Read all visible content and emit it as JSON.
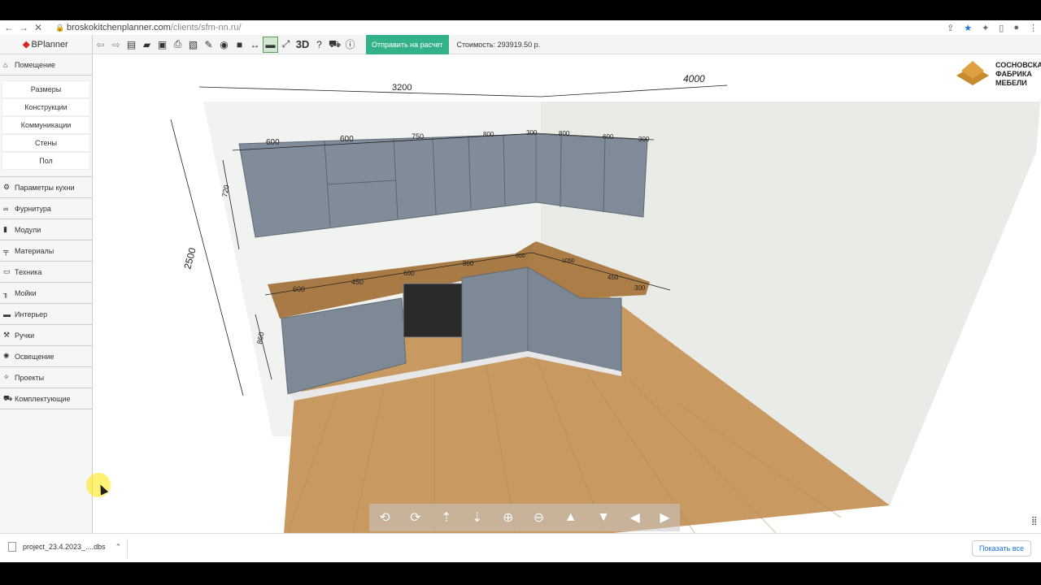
{
  "browser": {
    "url_host": "broskokitchenplanner.com",
    "url_path": "/clients/sfm-nn.ru/"
  },
  "app": {
    "logo": "BPlanner",
    "toolbar": {
      "three_d_label": "3D",
      "send_button": "Отправить на расчет",
      "cost": "Стоимость: 293919.50 р."
    },
    "sidebar": {
      "room": "Помещение",
      "room_items": [
        "Размеры",
        "Конструкции",
        "Коммуникации",
        "Стены",
        "Пол"
      ],
      "categories": [
        {
          "label": "Параметры кухни",
          "icon": "gear-icon"
        },
        {
          "label": "Фурнитура",
          "icon": "link-icon"
        },
        {
          "label": "Модули",
          "icon": "module-icon"
        },
        {
          "label": "Материалы",
          "icon": "brush-icon"
        },
        {
          "label": "Техника",
          "icon": "monitor-icon"
        },
        {
          "label": "Мойки",
          "icon": "sink-icon"
        },
        {
          "label": "Интерьер",
          "icon": "sofa-icon"
        },
        {
          "label": "Ручки",
          "icon": "hammer-icon"
        },
        {
          "label": "Освещение",
          "icon": "bulb-icon"
        },
        {
          "label": "Проекты",
          "icon": "wand-icon"
        },
        {
          "label": "Комплектующие",
          "icon": "cart-icon"
        }
      ]
    },
    "company": [
      "СОСНОВСКА",
      "ФАБРИКА",
      "МЕБЕЛИ"
    ],
    "dimensions": {
      "wall_left": "3200",
      "wall_right": "4000",
      "height": "2500",
      "upper_height": "720",
      "lower_height": "860",
      "upper_left": [
        "600",
        "600",
        "750",
        "800",
        "300"
      ],
      "upper_right": [
        "800",
        "600",
        "300"
      ],
      "lower_left": [
        "600",
        "450",
        "600",
        "800",
        "600"
      ],
      "lower_right": [
        "1050",
        "450",
        "300"
      ]
    }
  },
  "downloads": {
    "file": "project_23.4.2023_....dbs",
    "show_all": "Показать все"
  }
}
